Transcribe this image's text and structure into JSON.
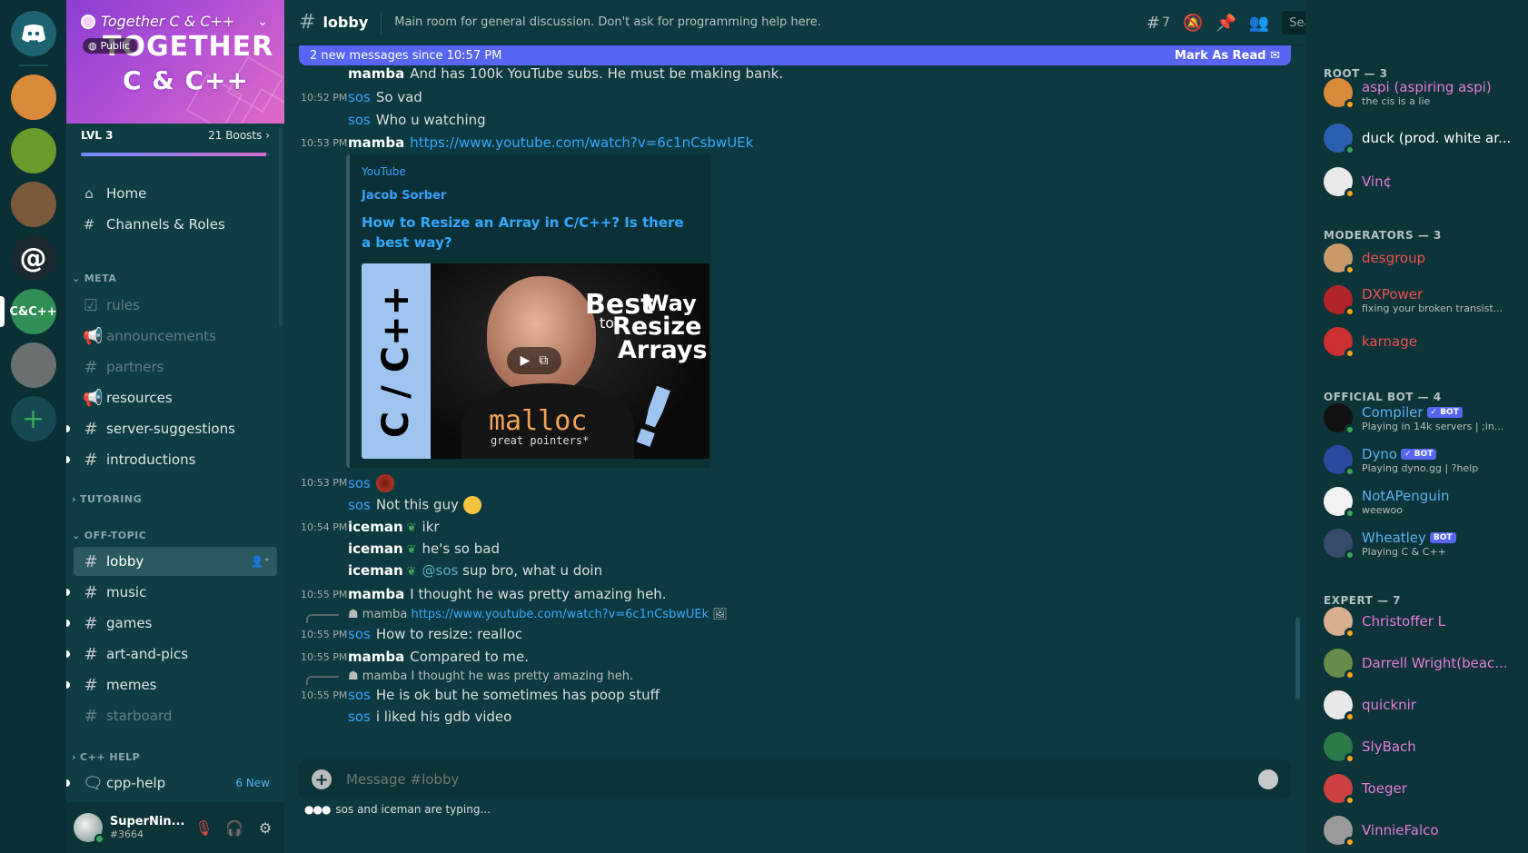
{
  "servers": [
    {
      "name": "discord-home",
      "color": "#1e6470"
    },
    {
      "name": "server-anime-1",
      "color": "#d98a3a"
    },
    {
      "name": "server-green-gem",
      "color": "#6a9a2a"
    },
    {
      "name": "server-mascot",
      "color": "#7a5a3a"
    },
    {
      "name": "server-at",
      "color": "#1a2a30"
    },
    {
      "name": "server-together-cpp",
      "color": "#2f8f55",
      "label": "C&C++"
    },
    {
      "name": "server-dune-buggy",
      "color": "#6a7070"
    }
  ],
  "server": {
    "name": "Together C & C++",
    "public_label": "Public",
    "logo_line1": "TOGETHER",
    "logo_line2": "C & C++",
    "level": "LVL 3",
    "boosts": "21 Boosts",
    "boost_progress": 0.98
  },
  "nav": [
    {
      "label": "Home",
      "icon": "house-icon"
    },
    {
      "label": "Channels & Roles",
      "icon": "channels-roles-icon"
    }
  ],
  "categories": {
    "meta": "META",
    "tutoring": "TUTORING",
    "off_topic": "OFF-TOPIC",
    "cpp_help": "C++ HELP"
  },
  "channels_meta": [
    {
      "label": "rules",
      "icon": "checkbox-icon",
      "muted": true
    },
    {
      "label": "announcements",
      "icon": "megaphone-icon",
      "muted": true
    },
    {
      "label": "partners",
      "icon": "hash-icon",
      "muted": true
    },
    {
      "label": "resources",
      "icon": "megaphone-icon",
      "muted": false
    },
    {
      "label": "server-suggestions",
      "icon": "hash-thread-icon",
      "muted": false,
      "unread": true
    },
    {
      "label": "introductions",
      "icon": "hash-thread-icon",
      "muted": false,
      "unread": true
    }
  ],
  "channels_offtopic": [
    {
      "label": "lobby",
      "active": true
    },
    {
      "label": "music",
      "unread": true
    },
    {
      "label": "games",
      "unread": true
    },
    {
      "label": "art-and-pics",
      "unread": true
    },
    {
      "label": "memes",
      "unread": true
    },
    {
      "label": "starboard",
      "muted": true
    }
  ],
  "channel_cpphelp": {
    "label": "cpp-help",
    "new_count": "6 New"
  },
  "user": {
    "name": "SuperNin...",
    "discriminator": "#3664"
  },
  "topbar": {
    "channel": "lobby",
    "topic": "Main room for general discussion. Don't ask for programming help here.",
    "threads_count": "7",
    "search_placeholder": "Search"
  },
  "newbar": {
    "text": "2 new messages since 10:57 PM",
    "mark_read": "Mark As Read"
  },
  "messages": {
    "m1": {
      "author": "mamba",
      "text": "And has 100k YouTube subs. He must be making bank."
    },
    "m2": {
      "time": "10:52 PM",
      "author": "sos",
      "text": "So vad"
    },
    "m3": {
      "author": "sos",
      "text": "Who u watching"
    },
    "m4": {
      "time": "10:53 PM",
      "author": "mamba",
      "link": "https://www.youtube.com/watch?v=6c1nCsbwUEk"
    },
    "embed": {
      "provider": "YouTube",
      "author": "Jacob Sorber",
      "title": "How to Resize an Array in C/C++? Is there a best way?",
      "thumb_side": "C / C++",
      "thumb_best": "Best",
      "thumb_to": "to",
      "thumb_way": "Way",
      "thumb_resize": "Resize",
      "thumb_arrays": "Arrays",
      "thumb_malloc": "malloc",
      "thumb_gp": "great pointers*"
    },
    "m5": {
      "time": "10:53 PM",
      "author": "sos"
    },
    "m6": {
      "author": "sos",
      "text": "Not this guy"
    },
    "m7": {
      "time": "10:54 PM",
      "author": "iceman",
      "text": "ikr"
    },
    "m8": {
      "author": "iceman",
      "text": "he's so bad"
    },
    "m9": {
      "author": "iceman",
      "mention": "@sos",
      "text": "sup bro, what u doin"
    },
    "m10": {
      "time": "10:55 PM",
      "author": "mamba",
      "text": "I thought he was pretty amazing heh."
    },
    "r11": {
      "author": "mamba",
      "text": "https://www.youtube.com/watch?v=6c1nCsbwUEk"
    },
    "m11": {
      "time": "10:55 PM",
      "author": "sos",
      "text": "How to resize: realloc"
    },
    "m12": {
      "time": "10:55 PM",
      "author": "mamba",
      "text": "Compared to me."
    },
    "r13": {
      "author": "mamba",
      "text": "I thought he was pretty amazing heh."
    },
    "m13": {
      "time": "10:55 PM",
      "author": "sos",
      "text": "He is ok but he sometimes has poop stuff"
    },
    "m14": {
      "author": "sos",
      "text": "i liked his gdb video"
    }
  },
  "composer": {
    "placeholder": "Message #lobby"
  },
  "typing": "sos and iceman are typing...",
  "members": {
    "root": {
      "title": "ROOT — 3",
      "items": [
        {
          "name": "aspi (aspiring aspi)",
          "sub": "the cis is a lie",
          "color": "#e77bd6",
          "av": "#d98a3a",
          "status": "#faa61a"
        },
        {
          "name": "duck (prod. white ar...",
          "sub": "",
          "color": "#ffffff",
          "av": "#2b5fb0",
          "status": "#3ba55d"
        },
        {
          "name": "Vin¢",
          "sub": "",
          "color": "#e77bd6",
          "av": "#e9e9e9",
          "status": "#faa61a"
        }
      ]
    },
    "mods": {
      "title": "MODERATORS — 3",
      "items": [
        {
          "name": "desgroup",
          "sub": "",
          "color": "#f0504f",
          "av": "#c89a6a",
          "status": "#faa61a"
        },
        {
          "name": "DXPower",
          "sub": "fixing your broken transist...",
          "color": "#f0504f",
          "av": "#b0242a",
          "status": "#faa61a"
        },
        {
          "name": "karnage",
          "sub": "",
          "color": "#f0504f",
          "av": "#cc3030",
          "status": "#faa61a"
        }
      ]
    },
    "bots": {
      "title": "OFFICIAL BOT — 4",
      "items": [
        {
          "name": "Compiler",
          "sub": "Playing in 14k servers | ;in...",
          "color": "#5bb1f0",
          "av": "#111111",
          "status": "#3ba55d",
          "bot": "✓ BOT"
        },
        {
          "name": "Dyno",
          "sub": "Playing dyno.gg | ?help",
          "color": "#5bb1f0",
          "av": "#2a4aa0",
          "status": "#3ba55d",
          "bot": "✓ BOT"
        },
        {
          "name": "NotAPenguin",
          "sub": "weewoo",
          "color": "#5bb1f0",
          "av": "#f2f2f2",
          "status": "#3ba55d"
        },
        {
          "name": "Wheatley",
          "sub": "Playing C & C++",
          "color": "#5bb1f0",
          "av": "#3a4a6a",
          "status": "#3ba55d",
          "bot": "BOT"
        }
      ]
    },
    "expert": {
      "title": "EXPERT — 7",
      "items": [
        {
          "name": "Christoffer L",
          "sub": "",
          "color": "#e77bd6",
          "av": "#d8b090",
          "status": "#faa61a"
        },
        {
          "name": "Darrell Wright(beac...",
          "sub": "",
          "color": "#e77bd6",
          "av": "#6a8a4a",
          "status": "#faa61a"
        },
        {
          "name": "quicknir",
          "sub": "",
          "color": "#e77bd6",
          "av": "#e8e8e8",
          "status": "#faa61a"
        },
        {
          "name": "SlyBach",
          "sub": "",
          "color": "#e77bd6",
          "av": "#2a7a4a",
          "status": "#faa61a"
        },
        {
          "name": "Toeger",
          "sub": "",
          "color": "#e77bd6",
          "av": "#cc4040",
          "status": "#faa61a"
        },
        {
          "name": "VinnieFalco",
          "sub": "",
          "color": "#e77bd6",
          "av": "#9a9a9a",
          "status": "#faa61a"
        }
      ]
    }
  }
}
